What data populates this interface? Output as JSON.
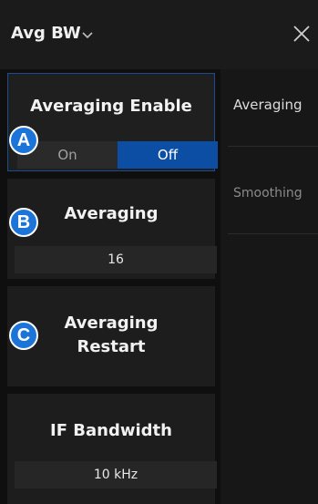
{
  "header": {
    "title": "Avg BW",
    "chevron_icon": "chevron-down-icon",
    "close_icon": "close-icon"
  },
  "cards": {
    "averaging_enable": {
      "title": "Averaging Enable",
      "options": [
        "On",
        "Off"
      ],
      "selected": "Off",
      "badge": "A"
    },
    "averaging": {
      "title": "Averaging",
      "value": "16",
      "badge": "B"
    },
    "averaging_restart": {
      "title_line1": "Averaging",
      "title_line2": "Restart",
      "badge": "C"
    },
    "if_bandwidth": {
      "title": "IF Bandwidth",
      "value": "10 kHz"
    }
  },
  "right_panel": {
    "item1": "Averaging",
    "item2": "Smoothing"
  },
  "colors": {
    "accent": "#0c4ea3",
    "badge": "#1c74d8"
  }
}
